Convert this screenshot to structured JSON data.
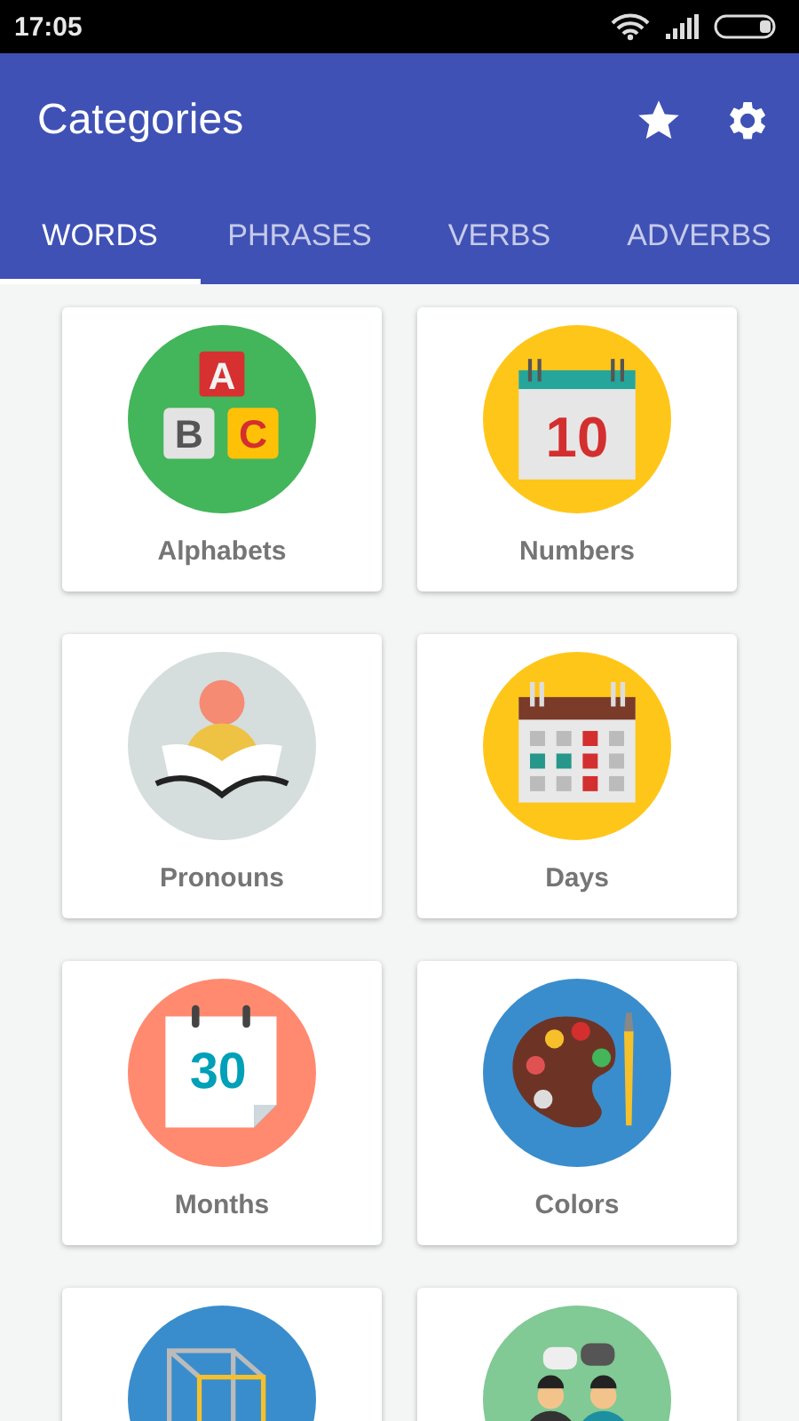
{
  "status_bar": {
    "time": "17:05"
  },
  "app_bar": {
    "title": "Categories"
  },
  "tabs": [
    {
      "label": "WORDS",
      "selected": true
    },
    {
      "label": "PHRASES",
      "selected": false
    },
    {
      "label": "VERBS",
      "selected": false
    },
    {
      "label": "ADVERBS",
      "selected": false
    }
  ],
  "cards": [
    {
      "label": "Alphabets",
      "glyphs": [
        "A",
        "B",
        "C"
      ]
    },
    {
      "label": "Numbers",
      "glyphs": [
        "10"
      ]
    },
    {
      "label": "Pronouns"
    },
    {
      "label": "Days"
    },
    {
      "label": "Months",
      "glyphs": [
        "30"
      ]
    },
    {
      "label": "Colors"
    },
    {
      "kind": "picture"
    },
    {
      "kind": "picture"
    }
  ]
}
